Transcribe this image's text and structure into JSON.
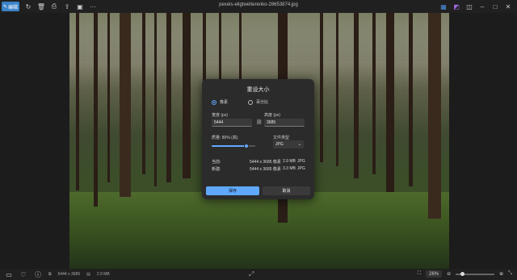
{
  "toolbar": {
    "edit_label": "编辑",
    "filename": "pexels-eligtwelterenko-28653874.jpg"
  },
  "dialog": {
    "title": "重设大小",
    "radio_pixels": "像素",
    "radio_percent": "百分比",
    "width_label": "宽度 (px)",
    "width_value": "5444",
    "height_label": "高度 (px)",
    "height_value": "3685",
    "quality_label": "质量: 80% (高)",
    "quality_percent": 80,
    "filetype_label": "文件类型",
    "filetype_value": "JPG",
    "current_label": "当前:",
    "current_dims": "5444 x 3685 像素",
    "current_size": "2.9 MB",
    "current_type": "JPG",
    "new_label": "新建:",
    "new_dims": "5444 x 3685 像素",
    "new_size": "3.3 MB",
    "new_type": "JPG",
    "save_label": "保存",
    "cancel_label": "取消"
  },
  "statusbar": {
    "dimensions": "5444 x 3685",
    "filesize": "2.9 MB",
    "zoom": "26%"
  },
  "colors": {
    "accent": "#5fa8ff",
    "highlight": "#e0352b"
  }
}
